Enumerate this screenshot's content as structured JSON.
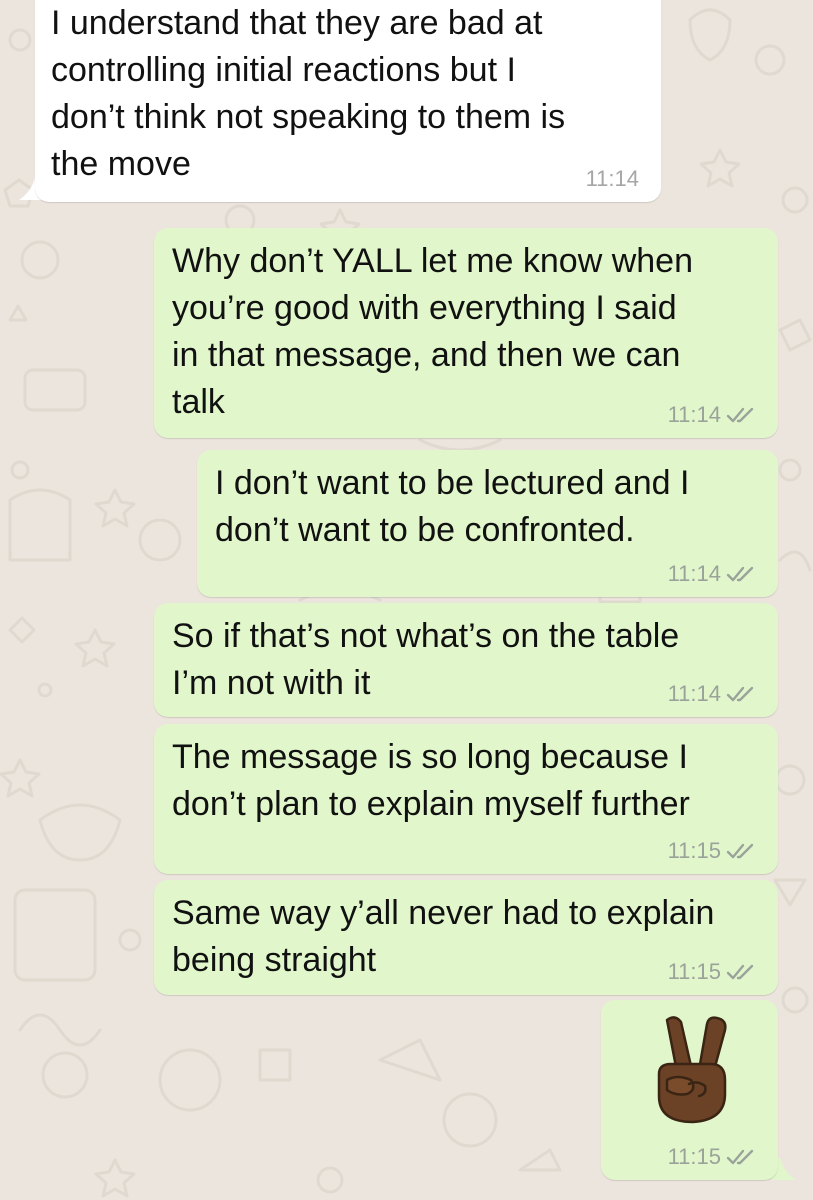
{
  "messages": [
    {
      "direction": "incoming",
      "text": "I understand that they are bad at\ncontrolling initial reactions but I\ndon’t think not speaking to them is\nthe move",
      "time": "11:14"
    },
    {
      "direction": "outgoing",
      "text": "Why don’t YALL let me know when\nyou’re good with everything I said\nin that message, and then we can\ntalk",
      "time": "11:14",
      "status_icon": "double-check-icon"
    },
    {
      "direction": "outgoing",
      "text": "I don’t want to be lectured and I\ndon’t want to be confronted.",
      "time": "11:14",
      "status_icon": "double-check-icon"
    },
    {
      "direction": "outgoing",
      "text": "So if that’s not what’s on the table\nI’m not with it",
      "time": "11:14",
      "status_icon": "double-check-icon"
    },
    {
      "direction": "outgoing",
      "text": "The message is so long because I\ndon’t plan to explain myself further",
      "time": "11:15",
      "status_icon": "double-check-icon"
    },
    {
      "direction": "outgoing",
      "text": "Same way y’all never had to explain\nbeing straight",
      "time": "11:15",
      "status_icon": "double-check-icon"
    },
    {
      "direction": "outgoing",
      "emoji": "victory-hand-emoji-medium-dark-skin-tone",
      "time": "11:15",
      "status_icon": "double-check-icon"
    }
  ],
  "colors": {
    "wallpaper": "#ece5dd",
    "incoming_bubble": "#ffffff",
    "outgoing_bubble": "#e1f7cb",
    "timestamp": "#9aa39a"
  }
}
